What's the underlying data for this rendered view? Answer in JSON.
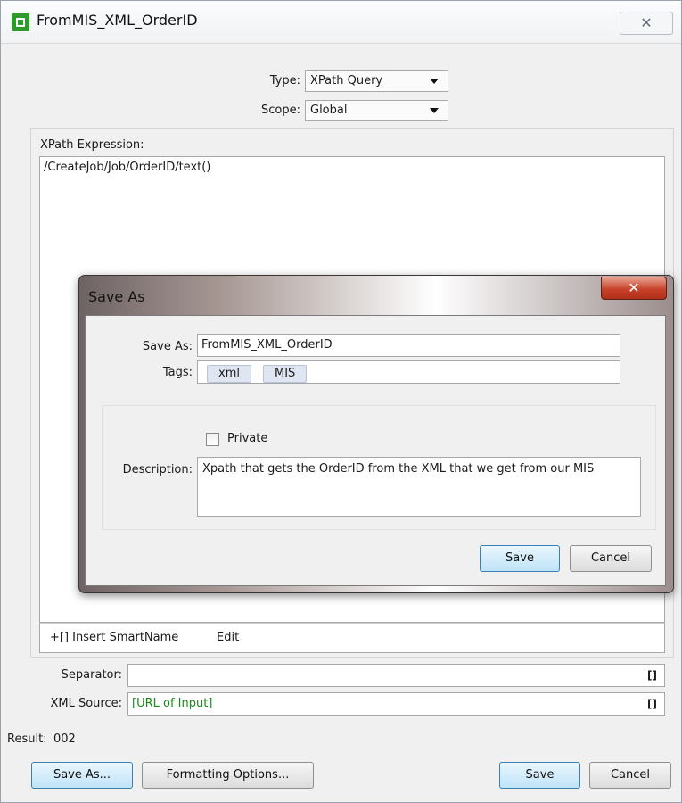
{
  "window": {
    "title": "FromMIS_XML_OrderID",
    "close_symbol": "✕"
  },
  "type_field": {
    "label": "Type:",
    "value": "XPath Query"
  },
  "scope_field": {
    "label": "Scope:",
    "value": "Global"
  },
  "xpath": {
    "label": "XPath Expression:",
    "value": "/CreateJob/Job/OrderID/text()"
  },
  "toolbar": {
    "insert_label": "+[] Insert SmartName",
    "edit_label": "Edit"
  },
  "separator": {
    "label": "Separator:",
    "value": "",
    "brackets": "[]"
  },
  "xml_source": {
    "label": "XML Source:",
    "value": "[URL of Input]",
    "brackets": "[]",
    "value_color": "#1a8a1a"
  },
  "result": {
    "label": "Result:",
    "value": "002"
  },
  "bottom_buttons": {
    "save_as": "Save As...",
    "formatting": "Formatting Options...",
    "save": "Save",
    "cancel": "Cancel"
  },
  "dialog": {
    "title": "Save As",
    "close_symbol": "✕",
    "save_as_label": "Save As:",
    "save_as_value": "FromMIS_XML_OrderID",
    "tags_label": "Tags:",
    "tags": [
      "xml",
      "MIS"
    ],
    "private_label": "Private",
    "private_checked": false,
    "description_label": "Description:",
    "description_value": "Xpath that gets the OrderID from the XML that we get from our MIS",
    "save_label": "Save",
    "cancel_label": "Cancel"
  },
  "colors": {
    "accent": "#3c7fb1",
    "close_red": "#c7422a",
    "app_icon_green": "#2e9a2e"
  }
}
